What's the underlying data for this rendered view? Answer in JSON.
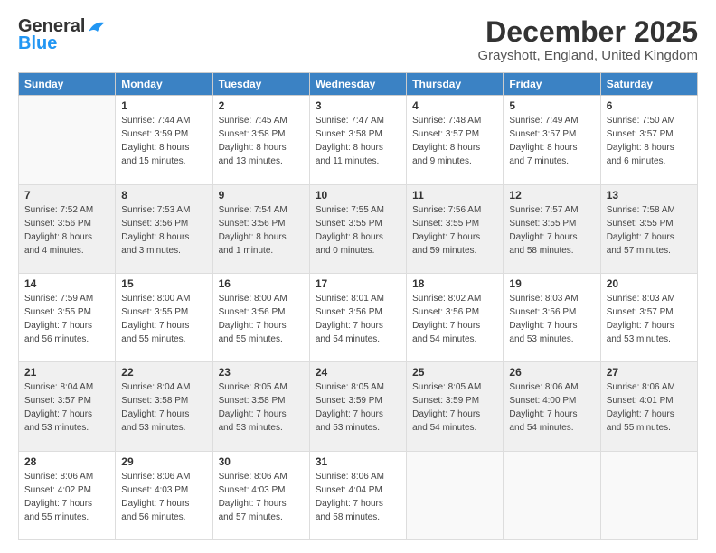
{
  "logo": {
    "general": "General",
    "blue": "Blue"
  },
  "title": "December 2025",
  "location": "Grayshott, England, United Kingdom",
  "days_header": [
    "Sunday",
    "Monday",
    "Tuesday",
    "Wednesday",
    "Thursday",
    "Friday",
    "Saturday"
  ],
  "weeks": [
    [
      {
        "day": "",
        "info": ""
      },
      {
        "day": "1",
        "info": "Sunrise: 7:44 AM\nSunset: 3:59 PM\nDaylight: 8 hours\nand 15 minutes."
      },
      {
        "day": "2",
        "info": "Sunrise: 7:45 AM\nSunset: 3:58 PM\nDaylight: 8 hours\nand 13 minutes."
      },
      {
        "day": "3",
        "info": "Sunrise: 7:47 AM\nSunset: 3:58 PM\nDaylight: 8 hours\nand 11 minutes."
      },
      {
        "day": "4",
        "info": "Sunrise: 7:48 AM\nSunset: 3:57 PM\nDaylight: 8 hours\nand 9 minutes."
      },
      {
        "day": "5",
        "info": "Sunrise: 7:49 AM\nSunset: 3:57 PM\nDaylight: 8 hours\nand 7 minutes."
      },
      {
        "day": "6",
        "info": "Sunrise: 7:50 AM\nSunset: 3:57 PM\nDaylight: 8 hours\nand 6 minutes."
      }
    ],
    [
      {
        "day": "7",
        "info": "Sunrise: 7:52 AM\nSunset: 3:56 PM\nDaylight: 8 hours\nand 4 minutes."
      },
      {
        "day": "8",
        "info": "Sunrise: 7:53 AM\nSunset: 3:56 PM\nDaylight: 8 hours\nand 3 minutes."
      },
      {
        "day": "9",
        "info": "Sunrise: 7:54 AM\nSunset: 3:56 PM\nDaylight: 8 hours\nand 1 minute."
      },
      {
        "day": "10",
        "info": "Sunrise: 7:55 AM\nSunset: 3:55 PM\nDaylight: 8 hours\nand 0 minutes."
      },
      {
        "day": "11",
        "info": "Sunrise: 7:56 AM\nSunset: 3:55 PM\nDaylight: 7 hours\nand 59 minutes."
      },
      {
        "day": "12",
        "info": "Sunrise: 7:57 AM\nSunset: 3:55 PM\nDaylight: 7 hours\nand 58 minutes."
      },
      {
        "day": "13",
        "info": "Sunrise: 7:58 AM\nSunset: 3:55 PM\nDaylight: 7 hours\nand 57 minutes."
      }
    ],
    [
      {
        "day": "14",
        "info": "Sunrise: 7:59 AM\nSunset: 3:55 PM\nDaylight: 7 hours\nand 56 minutes."
      },
      {
        "day": "15",
        "info": "Sunrise: 8:00 AM\nSunset: 3:55 PM\nDaylight: 7 hours\nand 55 minutes."
      },
      {
        "day": "16",
        "info": "Sunrise: 8:00 AM\nSunset: 3:56 PM\nDaylight: 7 hours\nand 55 minutes."
      },
      {
        "day": "17",
        "info": "Sunrise: 8:01 AM\nSunset: 3:56 PM\nDaylight: 7 hours\nand 54 minutes."
      },
      {
        "day": "18",
        "info": "Sunrise: 8:02 AM\nSunset: 3:56 PM\nDaylight: 7 hours\nand 54 minutes."
      },
      {
        "day": "19",
        "info": "Sunrise: 8:03 AM\nSunset: 3:56 PM\nDaylight: 7 hours\nand 53 minutes."
      },
      {
        "day": "20",
        "info": "Sunrise: 8:03 AM\nSunset: 3:57 PM\nDaylight: 7 hours\nand 53 minutes."
      }
    ],
    [
      {
        "day": "21",
        "info": "Sunrise: 8:04 AM\nSunset: 3:57 PM\nDaylight: 7 hours\nand 53 minutes."
      },
      {
        "day": "22",
        "info": "Sunrise: 8:04 AM\nSunset: 3:58 PM\nDaylight: 7 hours\nand 53 minutes."
      },
      {
        "day": "23",
        "info": "Sunrise: 8:05 AM\nSunset: 3:58 PM\nDaylight: 7 hours\nand 53 minutes."
      },
      {
        "day": "24",
        "info": "Sunrise: 8:05 AM\nSunset: 3:59 PM\nDaylight: 7 hours\nand 53 minutes."
      },
      {
        "day": "25",
        "info": "Sunrise: 8:05 AM\nSunset: 3:59 PM\nDaylight: 7 hours\nand 54 minutes."
      },
      {
        "day": "26",
        "info": "Sunrise: 8:06 AM\nSunset: 4:00 PM\nDaylight: 7 hours\nand 54 minutes."
      },
      {
        "day": "27",
        "info": "Sunrise: 8:06 AM\nSunset: 4:01 PM\nDaylight: 7 hours\nand 55 minutes."
      }
    ],
    [
      {
        "day": "28",
        "info": "Sunrise: 8:06 AM\nSunset: 4:02 PM\nDaylight: 7 hours\nand 55 minutes."
      },
      {
        "day": "29",
        "info": "Sunrise: 8:06 AM\nSunset: 4:03 PM\nDaylight: 7 hours\nand 56 minutes."
      },
      {
        "day": "30",
        "info": "Sunrise: 8:06 AM\nSunset: 4:03 PM\nDaylight: 7 hours\nand 57 minutes."
      },
      {
        "day": "31",
        "info": "Sunrise: 8:06 AM\nSunset: 4:04 PM\nDaylight: 7 hours\nand 58 minutes."
      },
      {
        "day": "",
        "info": ""
      },
      {
        "day": "",
        "info": ""
      },
      {
        "day": "",
        "info": ""
      }
    ]
  ]
}
